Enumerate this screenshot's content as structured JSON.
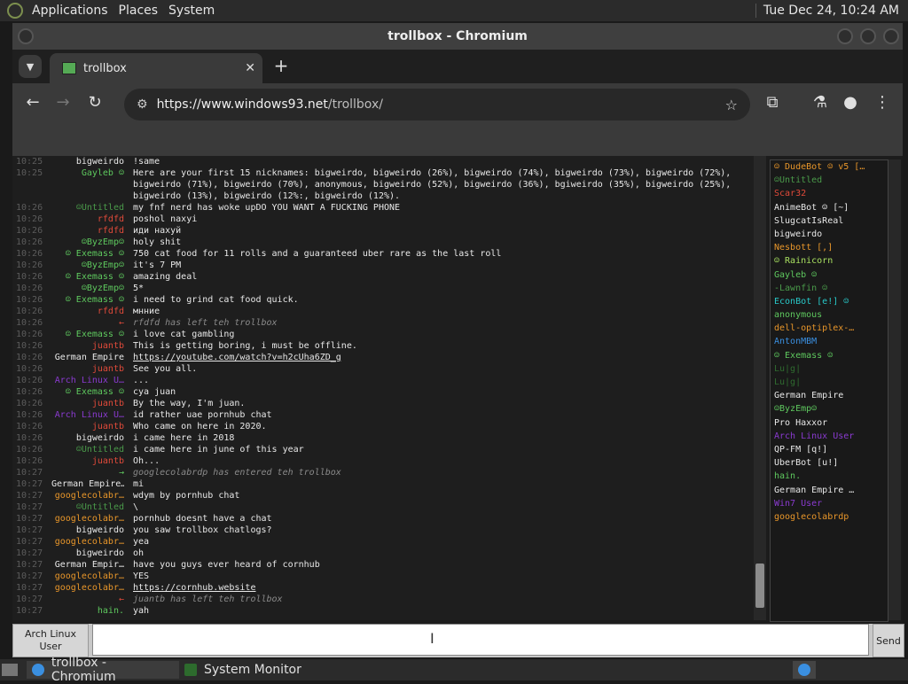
{
  "panel": {
    "menus": [
      "Applications",
      "Places",
      "System"
    ],
    "clock": "Tue Dec 24, 10:24 AM"
  },
  "window": {
    "title": "trollbox - Chromium"
  },
  "tab": {
    "title": "trollbox",
    "close": "✕",
    "new": "+"
  },
  "toolbar": {
    "url_host": "https://www.windows93.net",
    "url_path": "/trollbox/"
  },
  "colors": {
    "nick_green": "#5ec85e",
    "nick_red": "#e04a3a",
    "nick_purple": "#8a3ad0",
    "nick_orange": "#e8962a",
    "nick_blue": "#3a8fe0",
    "nick_white": "#e8e8e8",
    "nick_lime": "#a8e060",
    "nick_teal": "#28c8c8"
  },
  "messages": [
    {
      "time": "10:25",
      "nick": "bigweirdo",
      "color": "#e8e8e8",
      "text": "!same"
    },
    {
      "time": "10:25",
      "nick": "Gayleb ☺",
      "color": "#5ec85e",
      "text": "Here are your first 15 nicknames: bigweirdo, bigweirdo (26%), bigweirdo (74%), bigweirdo (73%), bigweirdo (72%), bigweirdo (71%), bigweirdo (70%), anonymous, bigweirdo (52%), bigweirdo (36%), bgiweirdo (35%), bigweirdo (25%), bigweirdo (13%), bigweirdo (12%:, bigweirdo (12%).",
      "wrap": true
    },
    {
      "time": "10:26",
      "nick": "☺Untitled",
      "color": "#4a9a4a",
      "text": "my fnf nerd has woke upDO YOU WANT A FUCKING PHONE"
    },
    {
      "time": "10:26",
      "nick": "rfdfd",
      "color": "#e04a3a",
      "text": "poshol naxyi"
    },
    {
      "time": "10:26",
      "nick": "rfdfd",
      "color": "#e04a3a",
      "text": "иди нахуй"
    },
    {
      "time": "10:26",
      "nick": "☺ByzEmp☺",
      "color": "#5ec85e",
      "text": "holy shit"
    },
    {
      "time": "10:26",
      "nick": "☺ Exemass ☺",
      "color": "#5ec85e",
      "text": "750 cat food for 11 rolls and a guaranteed uber rare as the last roll"
    },
    {
      "time": "10:26",
      "nick": "☺ByzEmp☺",
      "color": "#5ec85e",
      "text": "it's 7 PM"
    },
    {
      "time": "10:26",
      "nick": "☺ Exemass ☺",
      "color": "#5ec85e",
      "text": "amazing deal"
    },
    {
      "time": "10:26",
      "nick": "☺ByzEmp☺",
      "color": "#5ec85e",
      "text": "5*"
    },
    {
      "time": "10:26",
      "nick": "☺ Exemass ☺",
      "color": "#5ec85e",
      "text": "i need to grind cat food quick."
    },
    {
      "time": "10:26",
      "nick": "rfdfd",
      "color": "#e04a3a",
      "text": "мнние"
    },
    {
      "time": "10:26",
      "nick": "←",
      "color": "#e04a3a",
      "text": "rfdfd has left teh trollbox",
      "sys": true
    },
    {
      "time": "10:26",
      "nick": "☺ Exemass ☺",
      "color": "#5ec85e",
      "text": "i love cat gambling"
    },
    {
      "time": "10:26",
      "nick": "juantb",
      "color": "#e04a3a",
      "text": "This is getting boring, i must be offline."
    },
    {
      "time": "10:26",
      "nick": "German Empire",
      "color": "#e8e8e8",
      "text": "https://youtube.com/watch?v=h2cUha6ZD_g",
      "link": true
    },
    {
      "time": "10:26",
      "nick": "juantb",
      "color": "#e04a3a",
      "text": "See you all."
    },
    {
      "time": "10:26",
      "nick": "Arch Linux U…",
      "color": "#8a3ad0",
      "text": "..."
    },
    {
      "time": "10:26",
      "nick": "☺ Exemass ☺",
      "color": "#5ec85e",
      "text": "cya juan"
    },
    {
      "time": "10:26",
      "nick": "juantb",
      "color": "#e04a3a",
      "text": "By the way, I'm juan."
    },
    {
      "time": "10:26",
      "nick": "Arch Linux U…",
      "color": "#8a3ad0",
      "text": "id rather uae pornhub chat"
    },
    {
      "time": "10:26",
      "nick": "juantb",
      "color": "#e04a3a",
      "text": "Who came on here in 2020."
    },
    {
      "time": "10:26",
      "nick": "bigweirdo",
      "color": "#e8e8e8",
      "text": "i came here in 2018"
    },
    {
      "time": "10:26",
      "nick": "☺Untitled",
      "color": "#4a9a4a",
      "text": "i came here in june of this year"
    },
    {
      "time": "10:26",
      "nick": "juantb",
      "color": "#e04a3a",
      "text": "Oh..."
    },
    {
      "time": "10:27",
      "nick": "→",
      "color": "#5ec85e",
      "text": "googlecolabrdp has entered teh trollbox",
      "sys": true
    },
    {
      "time": "10:27",
      "nick": "German Empire…",
      "color": "#e8e8e8",
      "text": "mi"
    },
    {
      "time": "10:27",
      "nick": "googlecolabr…",
      "color": "#e8962a",
      "text": "wdym by pornhub chat"
    },
    {
      "time": "10:27",
      "nick": "☺Untitled",
      "color": "#4a9a4a",
      "text": "\\"
    },
    {
      "time": "10:27",
      "nick": "googlecolabr…",
      "color": "#e8962a",
      "text": "pornhub doesnt have a chat"
    },
    {
      "time": "10:27",
      "nick": "bigweirdo",
      "color": "#e8e8e8",
      "text": "you saw trollbox chatlogs?"
    },
    {
      "time": "10:27",
      "nick": "googlecolabr…",
      "color": "#e8962a",
      "text": "yea"
    },
    {
      "time": "10:27",
      "nick": "bigweirdo",
      "color": "#e8e8e8",
      "text": "oh"
    },
    {
      "time": "10:27",
      "nick": "German Empir…",
      "color": "#e8e8e8",
      "text": "have you guys ever heard of cornhub"
    },
    {
      "time": "10:27",
      "nick": "googlecolabr…",
      "color": "#e8962a",
      "text": "YES"
    },
    {
      "time": "10:27",
      "nick": "googlecolabr…",
      "color": "#e8962a",
      "text": "https://cornhub.website",
      "link": true
    },
    {
      "time": "10:27",
      "nick": "←",
      "color": "#e04a3a",
      "text": "juantb has left teh trollbox",
      "sys": true
    },
    {
      "time": "10:27",
      "nick": "hain.",
      "color": "#5ec85e",
      "text": "yah"
    }
  ],
  "users": [
    {
      "name": "☺ DudeBot ☺ v5 […",
      "color": "#e8962a"
    },
    {
      "name": "☺Untitled",
      "color": "#4a9a4a"
    },
    {
      "name": "Scar32",
      "color": "#e04a3a"
    },
    {
      "name": "AnimeBot ☺ [~]",
      "color": "#e8e8e8"
    },
    {
      "name": "SlugcatIsReal",
      "color": "#e8e8e8"
    },
    {
      "name": "bigweirdo",
      "color": "#e8e8e8"
    },
    {
      "name": "Nesbott [,]",
      "color": "#e8962a"
    },
    {
      "name": "☺ Rainicorn",
      "color": "#a8e060"
    },
    {
      "name": "Gayleb ☺",
      "color": "#5ec85e"
    },
    {
      "name": "-Lawnfin ☺",
      "color": "#4a9a4a"
    },
    {
      "name": "EconBot [e!] ☺",
      "color": "#28c8c8"
    },
    {
      "name": "anonymous",
      "color": "#5ec85e"
    },
    {
      "name": "dell-optiplex-…",
      "color": "#e8962a"
    },
    {
      "name": "AntonMBM",
      "color": "#3a8fe0"
    },
    {
      "name": "☺ Exemass ☺",
      "color": "#5ec85e"
    },
    {
      "name": "Lu|g|",
      "color": "#2f6b2f"
    },
    {
      "name": "Lu|g|",
      "color": "#2f6b2f"
    },
    {
      "name": "German Empire",
      "color": "#e8e8e8"
    },
    {
      "name": "☺ByzEmp☺",
      "color": "#5ec85e"
    },
    {
      "name": "Pro Haxxor",
      "color": "#e8e8e8"
    },
    {
      "name": "Arch Linux User",
      "color": "#8a3ad0"
    },
    {
      "name": "QP-FM [q!]",
      "color": "#e8e8e8"
    },
    {
      "name": "UberBot [u!]",
      "color": "#e8e8e8"
    },
    {
      "name": "hain.",
      "color": "#5ec85e"
    },
    {
      "name": "German Empire …",
      "color": "#e8e8e8"
    },
    {
      "name": "Win7 User",
      "color": "#8a3ad0"
    },
    {
      "name": "googlecolabrdp",
      "color": "#e8962a"
    }
  ],
  "input": {
    "nick_label": "Arch Linux User",
    "send_label": "Send",
    "value": ""
  },
  "taskbar": {
    "tasks": [
      "trollbox - Chromium",
      "System Monitor"
    ]
  }
}
